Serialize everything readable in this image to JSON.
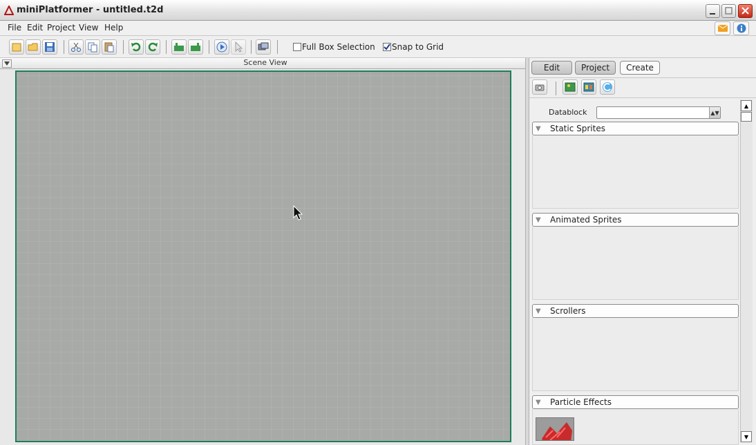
{
  "window": {
    "title": "miniPlatformer - untitled.t2d"
  },
  "menu": [
    "File",
    "Edit",
    "Project",
    "View",
    "Help"
  ],
  "toolbar": {
    "full_box_label": "Full Box Selection",
    "full_box_checked": false,
    "snap_label": "Snap to Grid",
    "snap_checked": true
  },
  "scene": {
    "title": "Scene View"
  },
  "panel": {
    "tabs": [
      "Edit",
      "Project",
      "Create"
    ],
    "datablock_label": "Datablock",
    "datablock_value": "",
    "sections": [
      "Static Sprites",
      "Animated Sprites",
      "Scrollers",
      "Particle Effects"
    ]
  },
  "icons": {
    "toolbar": [
      "new-icon",
      "open-icon",
      "save-icon",
      "cut-icon",
      "copy-icon",
      "paste-icon",
      "undo-icon",
      "redo-icon",
      "layer-up-icon",
      "layer-down-icon",
      "play-icon",
      "select-arrow-icon",
      "camera-view-icon"
    ],
    "panel": [
      "camera-icon",
      "add-image-icon",
      "add-animation-icon",
      "particle-icon"
    ]
  },
  "colors": {
    "scene_bg": "#a7aaa7",
    "scene_border": "#1e7c5a",
    "close_btn": "#c42a16"
  }
}
